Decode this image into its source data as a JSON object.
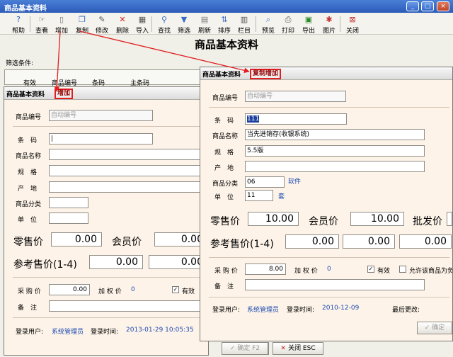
{
  "main": {
    "title": "商品基本资料",
    "heading": "商品基本资料",
    "filter_label": "筛选条件:",
    "grid_columns": [
      "有效",
      "商品编号",
      "条码",
      "主条码"
    ]
  },
  "window_buttons": [
    "_",
    "□",
    "×"
  ],
  "toolbar": [
    {
      "label": "帮助",
      "icon": "help-icon"
    },
    {
      "label": "查看",
      "icon": "view-icon"
    },
    {
      "label": "增加",
      "icon": "add-icon"
    },
    {
      "label": "复制",
      "icon": "copy-icon"
    },
    {
      "label": "修改",
      "icon": "edit-icon"
    },
    {
      "label": "删除",
      "icon": "delete-icon"
    },
    {
      "label": "导入",
      "icon": "import-icon"
    },
    {
      "label": "查找",
      "icon": "find-icon"
    },
    {
      "label": "筛选",
      "icon": "filter-icon"
    },
    {
      "label": "刷新",
      "icon": "refresh-icon"
    },
    {
      "label": "排序",
      "icon": "sort-icon"
    },
    {
      "label": "栏目",
      "icon": "columns-icon"
    },
    {
      "label": "预览",
      "icon": "preview-icon"
    },
    {
      "label": "打印",
      "icon": "print-icon"
    },
    {
      "label": "导出",
      "icon": "export-icon"
    },
    {
      "label": "图片",
      "icon": "picture-icon"
    },
    {
      "label": "关闭",
      "icon": "close-icon"
    }
  ],
  "add_dialog": {
    "title": "商品基本资料",
    "mode": "增加",
    "product_code_label": "商品编号",
    "product_code_value": "自动编号",
    "barcode_label": "条　码",
    "name_label": "商品名称",
    "spec_label": "规　格",
    "origin_label": "产　地",
    "category_label": "商品分类",
    "unit_label": "单　位",
    "retail_label": "零售价",
    "retail_value": "0.00",
    "member_label": "会员价",
    "member_value": "0.00",
    "ref_label": "参考售价(1-4)",
    "ref_values": [
      "0.00",
      "0.00"
    ],
    "purchase_label": "采 购 价",
    "purchase_value": "0.00",
    "weighted_label": "加 权 价",
    "weighted_value": "0",
    "valid_label": "有效",
    "note_label": "备　注",
    "user_label": "登录用户:",
    "user_value": "系统管理员",
    "time_label": "登录时间:",
    "time_value": "2013-01-29 10:05:35",
    "confirm_label": "确定 F2",
    "close_label": "关闭 ESC"
  },
  "copy_dialog": {
    "title": "商品基本资料",
    "mode": "复制增加",
    "product_code_label": "商品编号",
    "product_code_value": "自动编号",
    "barcode_label": "条　码",
    "barcode_value": "111",
    "name_label": "商品名称",
    "name_value": "当先进销存(收银系统)",
    "spec_label": "规　格",
    "spec_value": "5.5版",
    "origin_label": "产　地",
    "category_label": "商品分类",
    "category_value": "06",
    "category_name": "软件",
    "unit_label": "单　位",
    "unit_value": "11",
    "unit_name": "套",
    "retail_label": "零售价",
    "retail_value": "10.00",
    "member_label": "会员价",
    "member_value": "10.00",
    "wholesale_label": "批发价",
    "ref_label": "参考售价(1-4)",
    "ref_values": [
      "0.00",
      "0.00",
      "0.00"
    ],
    "purchase_label": "采 购 价",
    "purchase_value": "8.00",
    "weighted_label": "加 权 价",
    "weighted_value": "0",
    "valid_label": "有效",
    "allow_label": "允许该商品为负",
    "note_label": "备　注",
    "user_label": "登录用户:",
    "user_value": "系统管理员",
    "time_label": "登录时间:",
    "time_value": "2010-12-09",
    "last_change_label": "最后更改:",
    "confirm_label": "确定"
  },
  "colors": {
    "title_bar": "#2a5bb8",
    "dialog_bg": "#fdf3e8",
    "highlight": "#e02020",
    "link_blue": "#1d4bb4"
  }
}
